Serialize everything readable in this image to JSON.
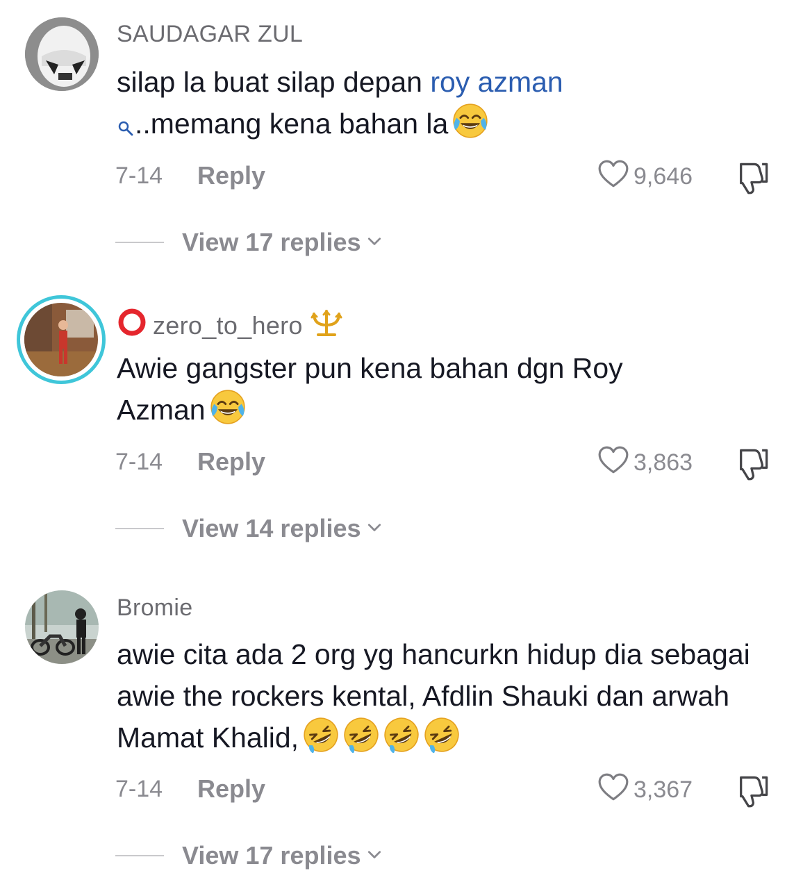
{
  "comments": [
    {
      "username": "SAUDAGAR ZUL",
      "text_before": "silap la buat silap depan ",
      "mention": "roy azman",
      "text_after": "..memang kena bahan la",
      "date": "7-14",
      "reply_label": "Reply",
      "likes": "9,646",
      "view_replies": "View 17 replies",
      "emoji": [
        "face-with-tears-of-joy"
      ]
    },
    {
      "username": "zero_to_hero",
      "text": "Awie gangster pun kena bahan dgn Roy Azman",
      "date": "7-14",
      "reply_label": "Reply",
      "likes": "3,863",
      "view_replies": "View 14 replies",
      "emoji": [
        "face-with-tears-of-joy"
      ],
      "badges": [
        "red-circle-icon",
        "trident-icon"
      ]
    },
    {
      "username": "Bromie",
      "text": "awie cita ada 2 org yg hancurkn hidup dia sebagai awie the rockers kental, Afdlin Shauki dan arwah Mamat Khalid,",
      "date": "7-14",
      "reply_label": "Reply",
      "likes": "3,367",
      "view_replies": "View 17 replies",
      "emoji": [
        "rolling-on-floor-laughing",
        "rolling-on-floor-laughing",
        "rolling-on-floor-laughing",
        "rolling-on-floor-laughing"
      ]
    }
  ],
  "colors": {
    "mention": "#2b5db0",
    "muted": "#8a8a90",
    "story_ring": "#3fc6d9",
    "badge_red": "#e5262d",
    "badge_gold": "#e0a21a"
  }
}
